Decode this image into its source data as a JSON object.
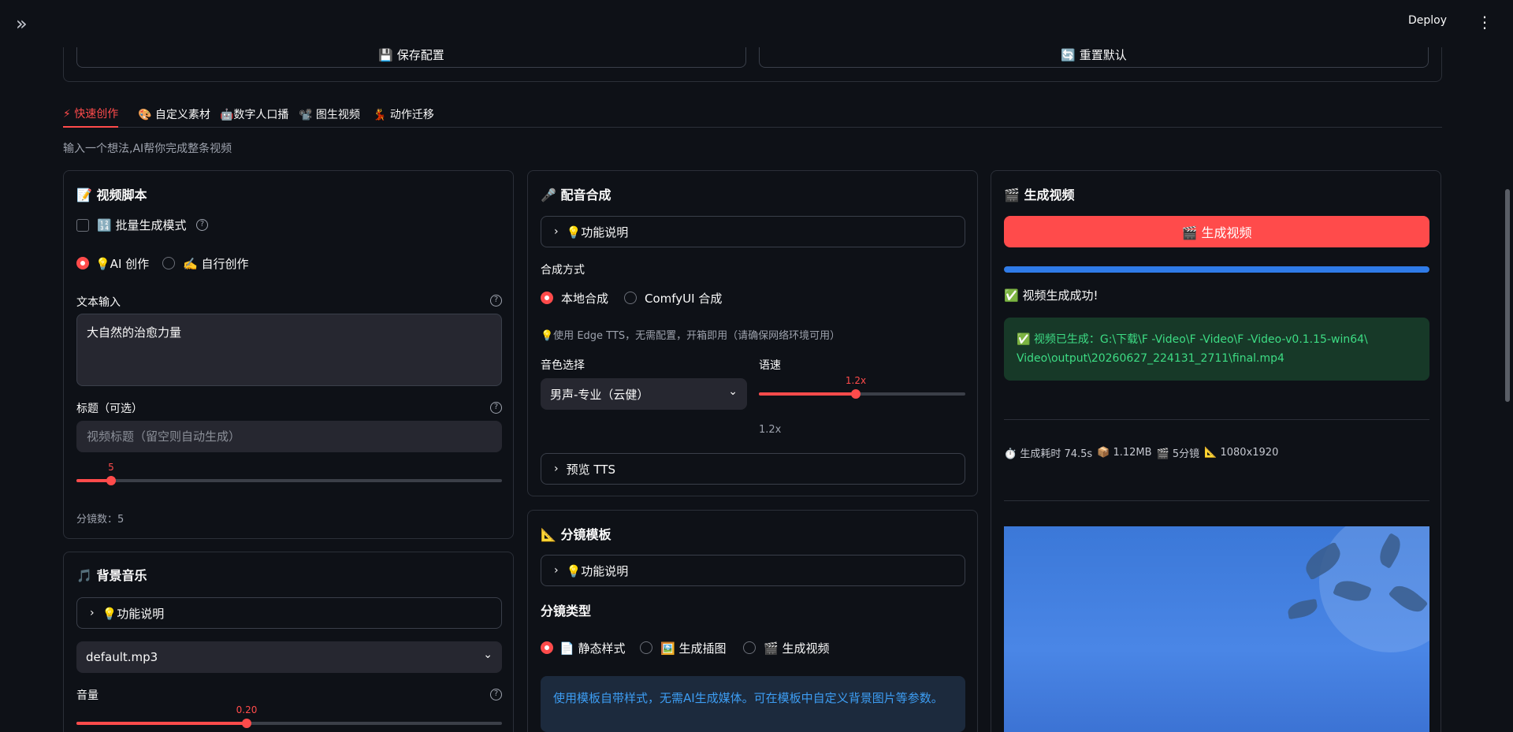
{
  "topbar": {
    "deploy_label": "Deploy"
  },
  "config": {
    "save_label": "💾 保存配置",
    "reset_label": "🔄 重置默认"
  },
  "tabs": [
    {
      "label": "⚡ 快速创作"
    },
    {
      "label": "🎨 自定义素材"
    },
    {
      "label": "🤖数字人口播"
    },
    {
      "label": "📽️ 图生视频"
    },
    {
      "label": "💃 动作迁移"
    }
  ],
  "subtitle": "输入一个想法,AI帮你完成整条视频",
  "script_card": {
    "title": "📝 视频脚本",
    "batch_label": "🔢 批量生成模式",
    "mode_ai": "💡AI 创作",
    "mode_self": "✍️ 自行创作",
    "text_label": "文本输入",
    "text_value": "大自然的治愈力量",
    "title_label": "标题（可选）",
    "title_placeholder": "视频标题（留空则自动生成）",
    "scene_slider_value": "5",
    "scene_slider_fraction": 0.083,
    "scene_count_text": "分镜数：5"
  },
  "bgm_card": {
    "title": "🎵 背景音乐",
    "help_label": "💡功能说明",
    "bgm_value": "default.mp3",
    "volume_label": "音量",
    "volume_value": "0.20",
    "volume_fraction": 0.4
  },
  "tts_card": {
    "title": "🎤 配音合成",
    "help_label": "💡功能说明",
    "method_label": "合成方式",
    "method_local": "本地合成",
    "method_comfy": "ComfyUI 合成",
    "hint": "💡使用 Edge TTS，无需配置，开箱即用（请确保网络环境可用）",
    "voice_label": "音色选择",
    "voice_value": "男声-专业（云健）",
    "speed_label": "语速",
    "speed_value": "1.2x",
    "speed_fraction": 0.47,
    "speed_caption": "1.2x",
    "preview_label": "预览 TTS"
  },
  "template_card": {
    "title": "📐 分镜模板",
    "help_label": "💡功能说明",
    "type_label": "分镜类型",
    "type_static": "📄 静态样式",
    "type_image": "🖼️ 生成插图",
    "type_video": "🎬 生成视频",
    "info": "使用模板自带样式，无需AI生成媒体。可在模板中自定义背景图片等参数。"
  },
  "video_card": {
    "title": "🎬 生成视频",
    "generate_label": "🎬 生成视频",
    "progress": 1.0,
    "success_title": "✅ 视频生成成功!",
    "output_prefix": "✅ 视频已生成：",
    "output_path": "G:\\下载\\F      -Video\\F      -Video\\F      -Video-v0.1.15-win64\\       Video\\output\\20260627_224131_2711\\final.mp4",
    "stat_time": "⏱️ 生成耗时 74.5s",
    "stat_size": "📦 1.12MB",
    "stat_scenes": "🎬 5分镜",
    "stat_res": "📐 1080x1920"
  },
  "colors": {
    "accent": "#ff4b4b",
    "background": "#0e1117",
    "progress": "#2f7be8",
    "success": "#3ddc84",
    "info": "#3d9df3"
  }
}
